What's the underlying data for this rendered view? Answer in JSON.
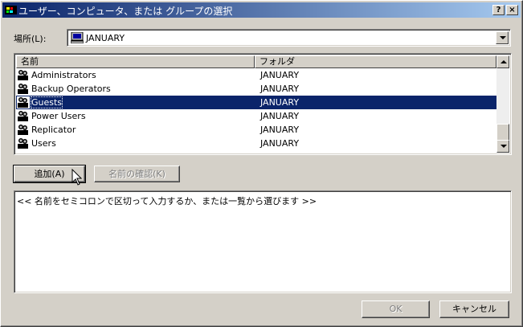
{
  "window": {
    "title": "ユーザー、コンピュータ、または グループの選択",
    "help_button": "?",
    "close_button": "×"
  },
  "location": {
    "label": "場所(L):",
    "value": "JANUARY"
  },
  "list": {
    "columns": [
      "名前",
      "フォルダ"
    ],
    "rows": [
      {
        "name": "Administrators",
        "folder": "JANUARY",
        "selected": false
      },
      {
        "name": "Backup Operators",
        "folder": "JANUARY",
        "selected": false
      },
      {
        "name": "Guests",
        "folder": "JANUARY",
        "selected": true
      },
      {
        "name": "Power Users",
        "folder": "JANUARY",
        "selected": false
      },
      {
        "name": "Replicator",
        "folder": "JANUARY",
        "selected": false
      },
      {
        "name": "Users",
        "folder": "JANUARY",
        "selected": false
      }
    ]
  },
  "buttons": {
    "add": "追加(A)",
    "check_names": "名前の確認(K)",
    "ok": "OK",
    "cancel": "キャンセル"
  },
  "names_box": {
    "text": "<< 名前をセミコロンで区切って入力するか、または一覧から選びます >>"
  },
  "colors": {
    "face": "#d4d0c8",
    "selection": "#0a246a",
    "title_start": "#0a246a",
    "title_end": "#a6caf0"
  },
  "icons": {
    "app": "window-app-icon",
    "location": "computer-icon",
    "group": "user-group-icon",
    "cursor": "mouse-pointer-icon"
  }
}
